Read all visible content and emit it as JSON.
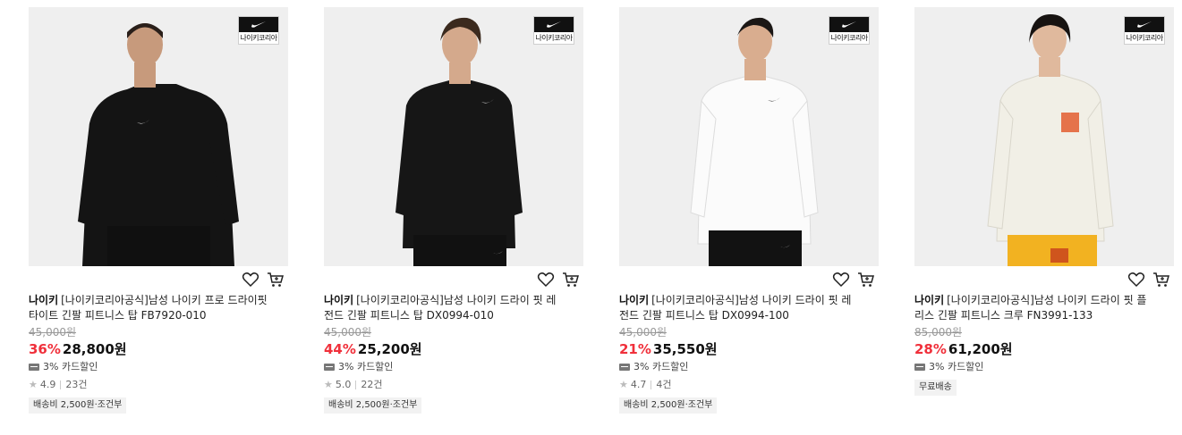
{
  "products": [
    {
      "brand": "나이키",
      "name": "[나이키코리아공식]남성 나이키 프로 드라이핏 타이트 긴팔 피트니스 탑 FB7920-010",
      "original_price": "45,000원",
      "discount": "36%",
      "price": "28,800원",
      "card_sale": "3% 카드할인",
      "rating": "4.9",
      "reviews": "23건",
      "shipping": "배송비 2,500원·조건부",
      "badge_text": "나이키코리아",
      "shirt_color": "#121212"
    },
    {
      "brand": "나이키",
      "name": "[나이키코리아공식]남성 나이키 드라이 핏 레전드 긴팔 피트니스 탑 DX0994-010",
      "original_price": "45,000원",
      "discount": "44%",
      "price": "25,200원",
      "card_sale": "3% 카드할인",
      "rating": "5.0",
      "reviews": "22건",
      "shipping": "배송비 2,500원·조건부",
      "badge_text": "나이키코리아",
      "shirt_color": "#151515"
    },
    {
      "brand": "나이키",
      "name": "[나이키코리아공식]남성 나이키 드라이 핏 레전드 긴팔 피트니스 탑 DX0994-100",
      "original_price": "45,000원",
      "discount": "21%",
      "price": "35,550원",
      "card_sale": "3% 카드할인",
      "rating": "4.7",
      "reviews": "4건",
      "shipping": "배송비 2,500원·조건부",
      "badge_text": "나이키코리아",
      "shirt_color": "#f7f7f7"
    },
    {
      "brand": "나이키",
      "name": "[나이키코리아공식]남성 나이키 드라이 핏 플리스 긴팔 피트니스 크루 FN3991-133",
      "original_price": "85,000원",
      "discount": "28%",
      "price": "61,200원",
      "card_sale": "3% 카드할인",
      "shipping": "무료배송",
      "badge_text": "나이키코리아",
      "shirt_color": "#efeee6"
    }
  ],
  "colors": {
    "discount": "#f0303b",
    "image_bg": "#efefef"
  }
}
